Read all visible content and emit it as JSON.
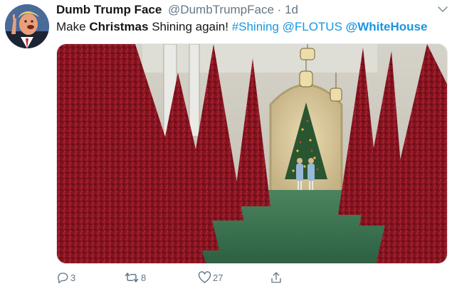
{
  "tweet": {
    "display_name": "Dumb Trump Face",
    "handle": "@DumbTrumpFace",
    "separator": "·",
    "age": "1d",
    "text": {
      "word_make": "Make",
      "word_christmas": "Christmas",
      "rest": "Shining again!",
      "hashtag": "#Shining",
      "mention_flotus": "@FLOTUS",
      "mention_whitehouse": "@WhiteHouse"
    }
  },
  "actions": {
    "reply_count": "3",
    "retweet_count": "8",
    "like_count": "27"
  },
  "icons": {
    "avatar": "caricature-avatar",
    "caret": "chevron-down-icon",
    "reply": "reply-icon",
    "retweet": "retweet-icon",
    "like": "heart-icon",
    "share": "share-icon"
  },
  "colors": {
    "link": "#1b95e0",
    "muted": "#657786",
    "tree_red": "#8e1424",
    "carpet_green": "#3f7a55"
  }
}
